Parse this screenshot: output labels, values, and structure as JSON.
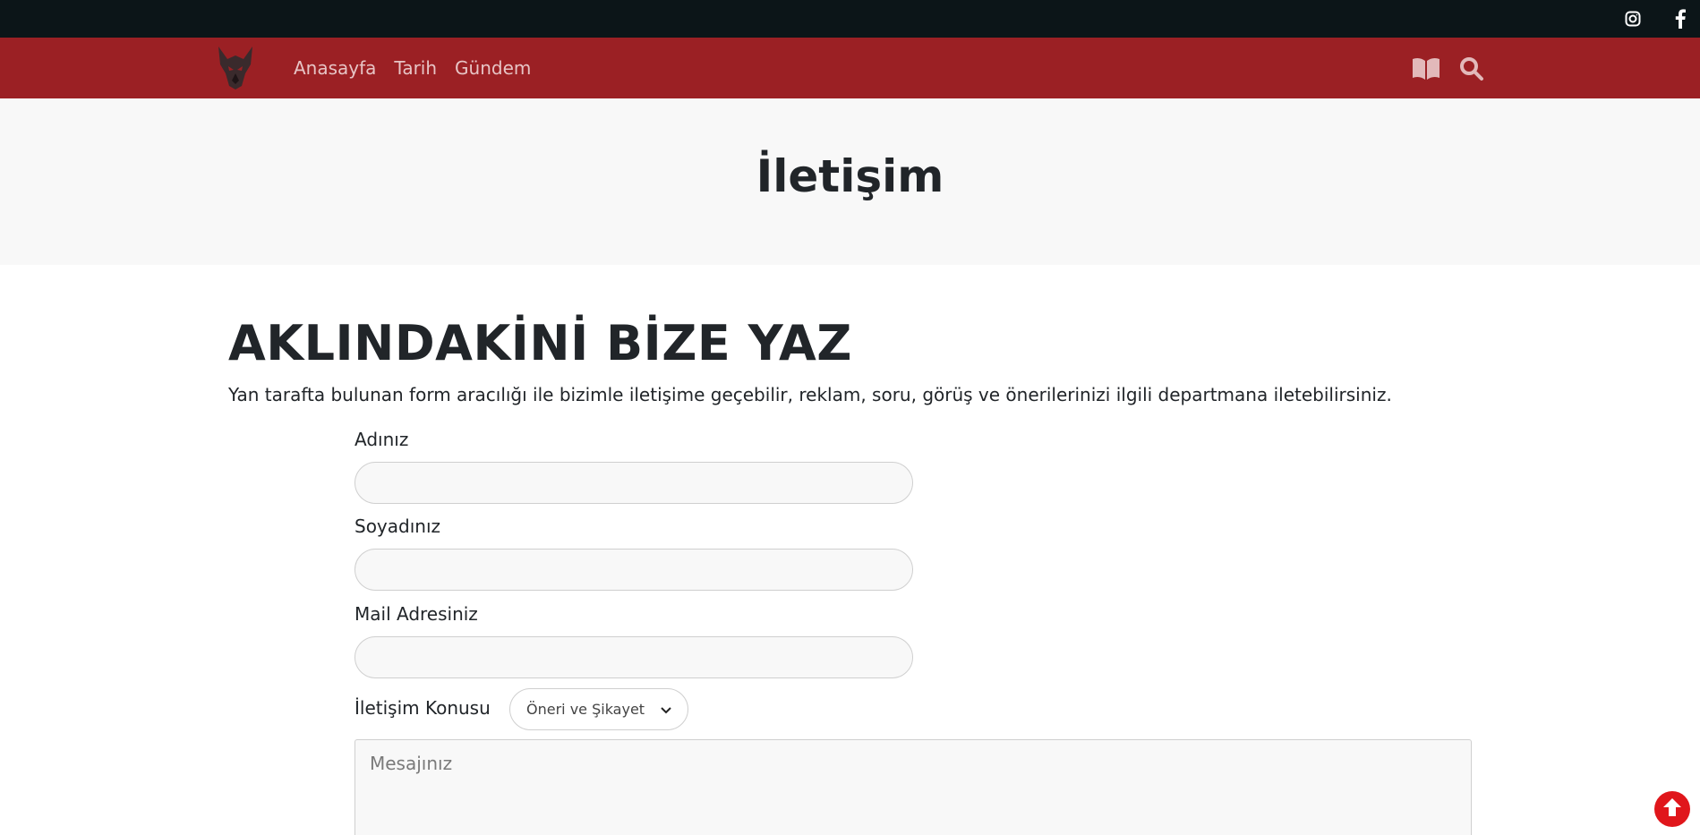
{
  "topbar": {
    "instagram_icon": "instagram-icon",
    "facebook_icon": "facebook-icon"
  },
  "navbar": {
    "logo": "wolf-head-logo",
    "links": [
      "Anasayfa",
      "Tarih",
      "Gündem"
    ],
    "book_icon": "book-icon",
    "search_icon": "search-icon"
  },
  "hero": {
    "title": "İletişim"
  },
  "section": {
    "title": "AKLINDAKİNİ BİZE YAZ",
    "description": "Yan tarafta bulunan form aracılığı ile bizimle iletişime geçebilir, reklam, soru, görüş ve önerilerinizi ilgili departmana iletebilirsiniz."
  },
  "form": {
    "first_name_label": "Adınız",
    "first_name_value": "",
    "last_name_label": "Soyadınız",
    "last_name_value": "",
    "email_label": "Mail Adresiniz",
    "email_value": "",
    "subject_label": "İletişim Konusu",
    "subject_selected": "Öneri ve Şikayet",
    "message_placeholder": "Mesajınız"
  },
  "colors": {
    "topbar": "#0c1518",
    "navbar": "#9b2024",
    "hero_bg": "#f8f8f8",
    "scroll_button": "#e0161b"
  }
}
